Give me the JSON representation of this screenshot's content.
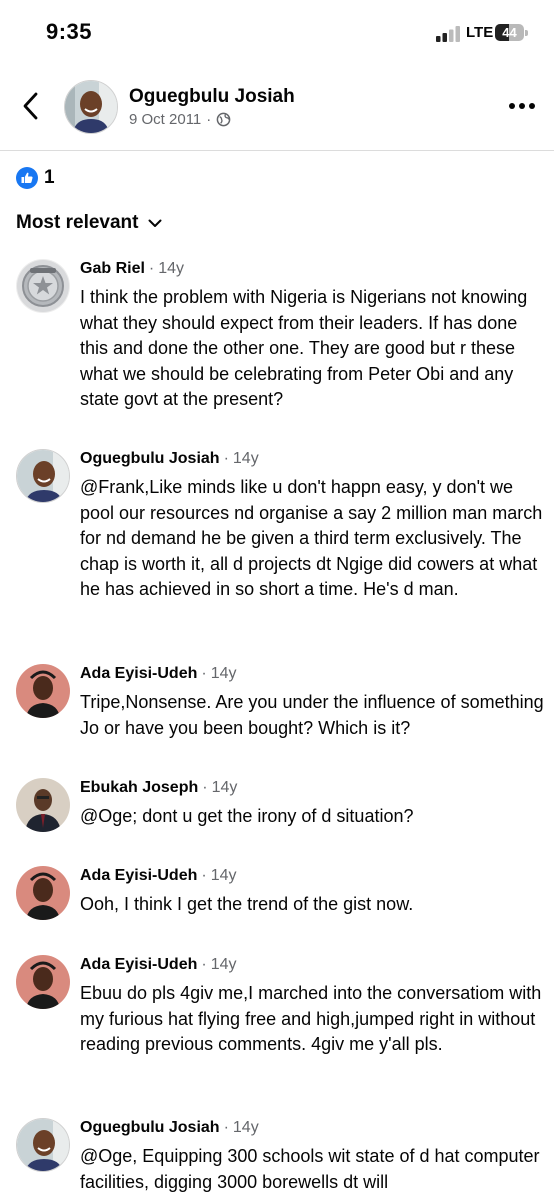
{
  "status": {
    "time": "9:35",
    "network": "LTE",
    "battery": "44"
  },
  "post": {
    "author": "Oguegbulu Josiah",
    "date": "9 Oct 2011",
    "separator": "·",
    "audience_icon": "globe-icon"
  },
  "reactions": {
    "icon": "like-icon",
    "count": "1"
  },
  "sort": {
    "label": "Most relevant"
  },
  "comments": [
    {
      "name": "Gab Riel",
      "sep": "·",
      "time": "14y",
      "avatar": "police-badge",
      "text": "I think the problem with Nigeria is Nigerians not knowing what they should expect from their leaders. If has done this and done the other one. They are good but r these what we should be celebrating from Peter Obi and any state govt at the present?"
    },
    {
      "name": "Oguegbulu Josiah",
      "sep": "·",
      "time": "14y",
      "avatar": "man-photo",
      "text": "@Frank,Like minds like u don't happn easy, y don't we pool our resources nd organise a say 2 million man march for nd demand he be given a third term exclusively. The chap is worth it, all d projects dt Ngige did cowers at  what he has achieved in so short a time. He's d man."
    },
    {
      "name": "Ada Eyisi-Udeh",
      "sep": "·",
      "time": "14y",
      "avatar": "woman-photo",
      "text": "Tripe,Nonsense. Are you under the influence of something Jo or have you been bought? Which is it?"
    },
    {
      "name": "Ebukah Joseph",
      "sep": "·",
      "time": "14y",
      "avatar": "man-suit-photo",
      "text": "@Oge; dont u get the irony of d situation?"
    },
    {
      "name": "Ada Eyisi-Udeh",
      "sep": "·",
      "time": "14y",
      "avatar": "woman-photo",
      "text": "Ooh, I think I get the trend of the gist now."
    },
    {
      "name": "Ada Eyisi-Udeh",
      "sep": "·",
      "time": "14y",
      "avatar": "woman-photo",
      "text": "Ebuu do pls 4giv me,I marched into the conversatiom with my furious hat flying free and high,jumped right in without reading previous comments. 4giv me y'all pls."
    },
    {
      "name": "Oguegbulu Josiah",
      "sep": "·",
      "time": "14y",
      "avatar": "man-photo",
      "text": "@Oge, Equipping 300 schools wit state of d hat computer facilities, digging 3000 borewells dt will"
    }
  ]
}
